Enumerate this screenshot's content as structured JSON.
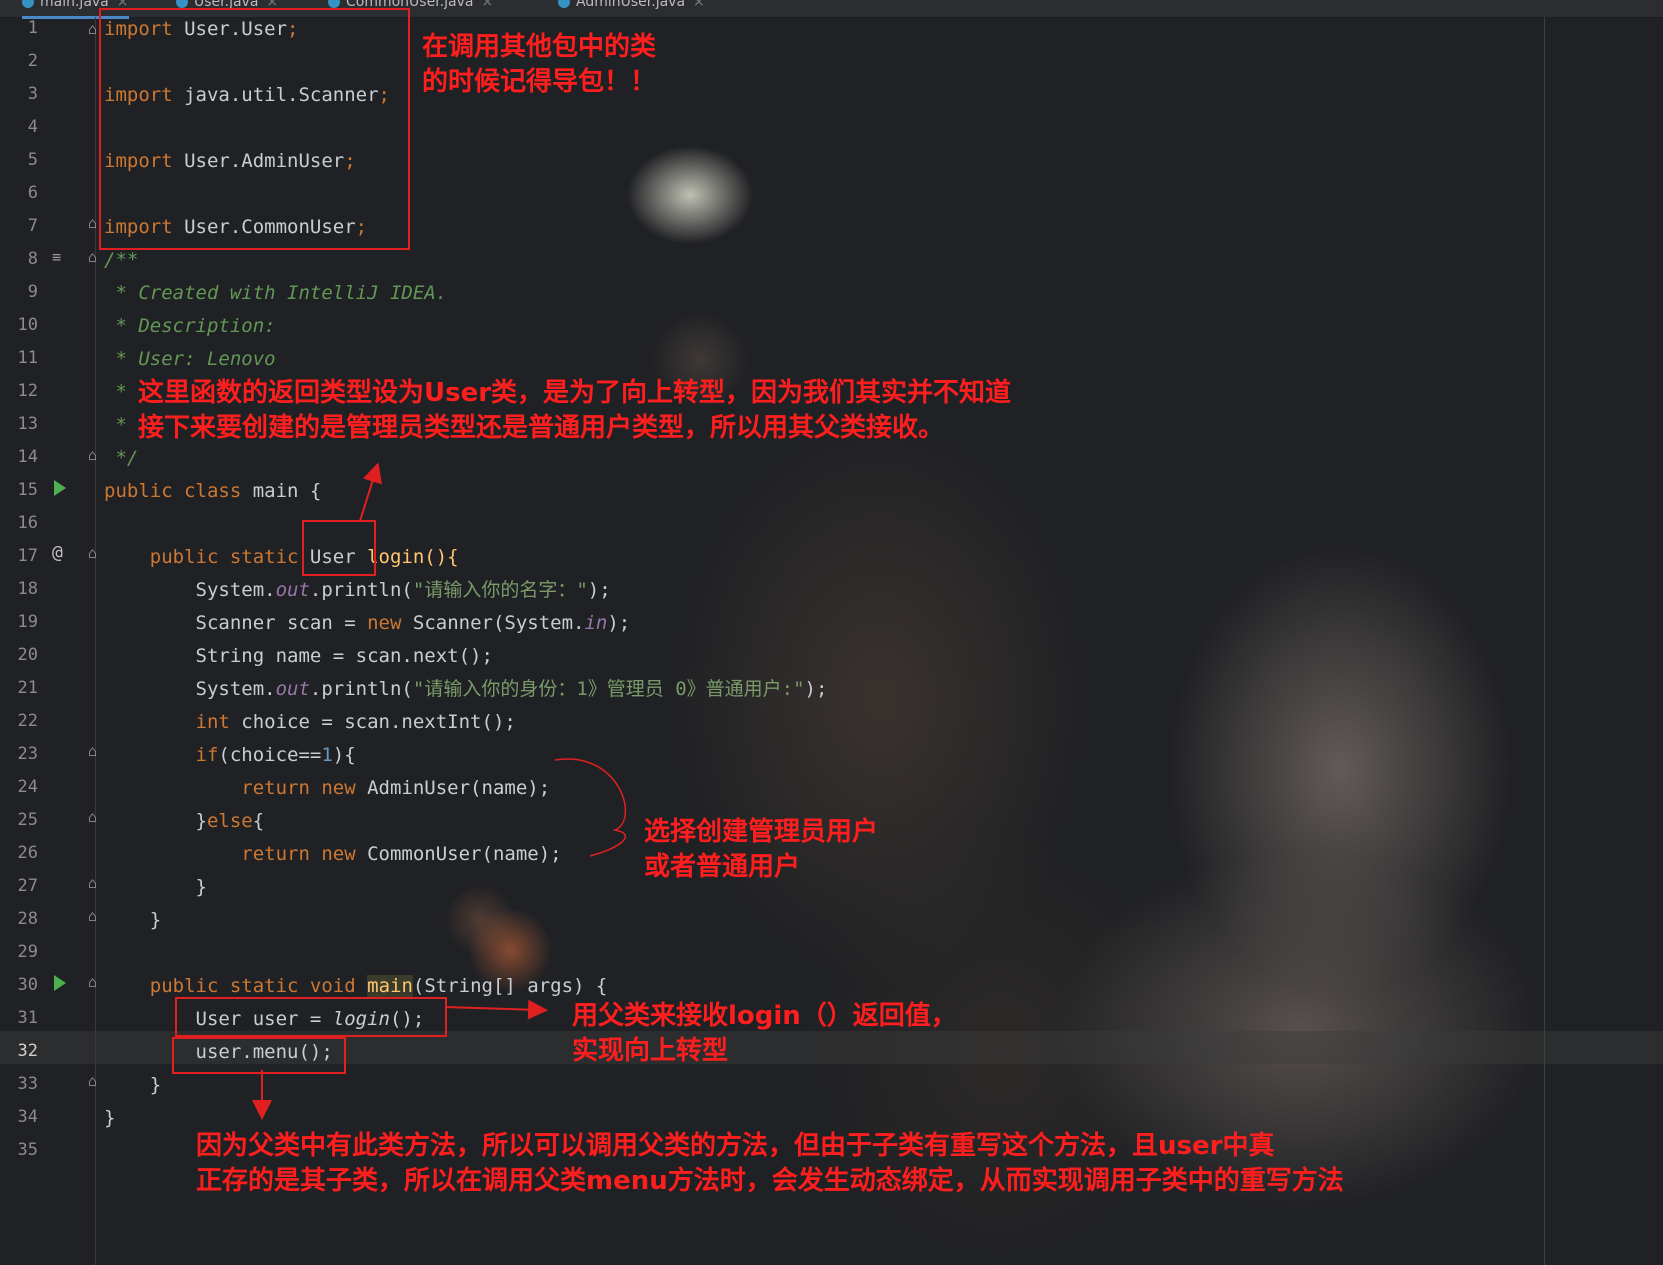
{
  "tabs": [
    {
      "label": "main.java"
    },
    {
      "label": "User.java"
    },
    {
      "label": "CommonUser.java"
    },
    {
      "label": "AdminUser.java"
    }
  ],
  "line_numbers": [
    "1",
    "2",
    "3",
    "4",
    "5",
    "6",
    "7",
    "8",
    "9",
    "10",
    "11",
    "12",
    "13",
    "14",
    "15",
    "16",
    "17",
    "18",
    "19",
    "20",
    "21",
    "22",
    "23",
    "24",
    "25",
    "26",
    "27",
    "28",
    "29",
    "30",
    "31",
    "32",
    "33",
    "34",
    "35"
  ],
  "code": {
    "l1_kw": "import",
    "l1_rest": " User.User",
    "l1_semi": ";",
    "l3_kw": "import",
    "l3_rest": " java.util.Scanner",
    "l3_semi": ";",
    "l5_kw": "import",
    "l5_rest": " User.AdminUser",
    "l5_semi": ";",
    "l7_kw": "import",
    "l7_rest": " User.CommonUser",
    "l7_semi": ";",
    "l8": "/**",
    "l9": " * Created with IntelliJ IDEA.",
    "l10": " * Description:",
    "l11": " * User: Lenovo",
    "l12": " * ",
    "l13": " * ",
    "l14": " */",
    "l15_kw": "public class",
    "l15_rest": " main {",
    "l17_kw": "    public static",
    "l17_type": " User",
    "l17_rest": " login(){",
    "l18_a": "        System.",
    "l18_fld": "out",
    "l18_b": ".println(",
    "l18_str": "\"请输入你的名字：\"",
    "l18_c": ");",
    "l19_a": "        Scanner scan = ",
    "l19_kw": "new",
    "l19_b": " Scanner(System.",
    "l19_fld": "in",
    "l19_c": ");",
    "l20": "        String name = scan.next();",
    "l21_a": "        System.",
    "l21_fld": "out",
    "l21_b": ".println(",
    "l21_str": "\"请输入你的身份：1》管理员 0》普通用户:\"",
    "l21_c": ");",
    "l22_kw": "        int",
    "l22_rest": " choice = scan.nextInt();",
    "l23_kw": "        if",
    "l23_a": "(choice==",
    "l23_num": "1",
    "l23_b": "){",
    "l24_kw": "            return new",
    "l24_rest": " AdminUser(name);",
    "l25_a": "        }",
    "l25_kw": "else",
    "l25_b": "{",
    "l26_kw": "            return new",
    "l26_rest": " CommonUser(name);",
    "l27": "        }",
    "l28": "    }",
    "l30_kw": "    public static void",
    "l30_sp": " ",
    "l30_main": "main",
    "l30_rest": "(String[] args) {",
    "l31_a": "        User user = ",
    "l31_it": "login",
    "l31_b": "();",
    "l32": "        user.menu();",
    "l33": "    }",
    "l34": "}"
  },
  "annotations": {
    "imports_note": "在调用其他包中的类\n的时候记得导包！！",
    "return_type_note": "这里函数的返回类型设为User类，是为了向上转型，因为我们其实并不知道\n接下来要创建的是管理员类型还是普通用户类型，所以用其父类接收。",
    "choice_note": "选择创建管理员用户\n或者普通用户",
    "upcast_note": "用父类来接收login（）返回值，\n实现向上转型",
    "dynamic_binding_note": "因为父类中有此类方法，所以可以调用父类的方法，但由于子类有重写这个方法，且user中真\n正存的是其子类，所以在调用父类menu方法时，会发生动态绑定，从而实现调用子类中的重写方法"
  },
  "colors": {
    "keyword": "#cc7832",
    "comment": "#629755",
    "field": "#9876aa",
    "string": "#7a9a6a",
    "number": "#6897bb",
    "annotation_red": "#ff1e1e"
  }
}
